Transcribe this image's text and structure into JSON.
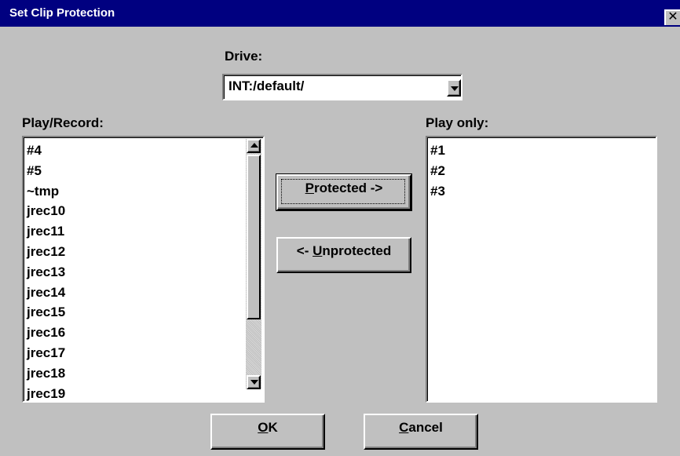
{
  "window": {
    "title": "Set Clip Protection",
    "close_glyph": "✕"
  },
  "drive": {
    "label": "Drive:",
    "value": "INT:/default/"
  },
  "play_record": {
    "label": "Play/Record:",
    "items": [
      "#4",
      "#5",
      "~tmp",
      "jrec10",
      "jrec11",
      "jrec12",
      "jrec13",
      "jrec14",
      "jrec15",
      "jrec16",
      "jrec17",
      "jrec18",
      "jrec19"
    ]
  },
  "play_only": {
    "label": "Play only:",
    "items": [
      "#1",
      "#2",
      "#3"
    ]
  },
  "buttons": {
    "protect": {
      "mnemonic": "P",
      "rest": "rotected ->"
    },
    "unprotect": {
      "prefix": "<- ",
      "mnemonic": "U",
      "rest": "nprotected"
    },
    "ok": {
      "mnemonic": "O",
      "rest": "K"
    },
    "cancel": {
      "mnemonic": "C",
      "rest": "ancel"
    }
  },
  "icons": {
    "dropdown": "chevron-down-icon",
    "close": "close-icon"
  }
}
